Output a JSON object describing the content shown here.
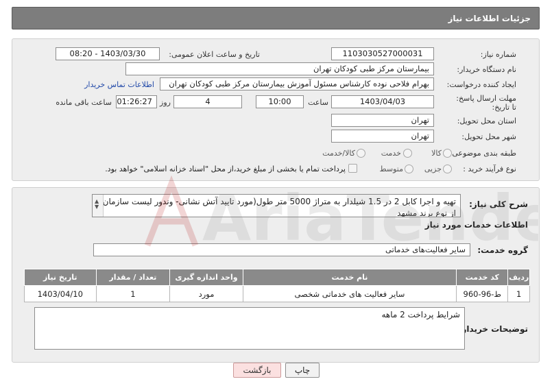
{
  "header": {
    "title": "جزئیات اطلاعات نیاز"
  },
  "details": {
    "need_number_label": "شماره نیاز:",
    "need_number": "1103030527000031",
    "announce_label": "تاریخ و ساعت اعلان عمومی:",
    "announce_value": "1403/03/30 - 08:20",
    "buyer_org_label": "نام دستگاه خریدار:",
    "buyer_org": "بیمارستان مرکز طبی کودکان تهران",
    "creator_label": "ایجاد کننده درخواست:",
    "creator": "بهرام فلاحی نوده کارشناس مسئول آموزش بیمارستان مرکز طبی کودکان تهران",
    "contact_link": "اطلاعات تماس خریدار",
    "deadline_label": "مهلت ارسال پاسخ: تا تاریخ:",
    "deadline_date": "1403/04/03",
    "time_label": "ساعت",
    "deadline_time": "10:00",
    "days_value": "4",
    "days_label": "روز و",
    "remaining_time": "01:26:27",
    "remaining_label": "ساعت باقی مانده",
    "province_label": "استان محل تحویل:",
    "province": "تهران",
    "city_label": "شهر محل تحویل:",
    "city": "تهران",
    "category_label": "طبقه بندی موضوعی:",
    "category_options": [
      "کالا",
      "خدمت",
      "کالا/خدمت"
    ],
    "process_label": "نوع فرآیند خرید :",
    "process_options": [
      "جزیی",
      "متوسط"
    ],
    "payment_note": "پرداخت تمام یا بخشی از مبلغ خرید،از محل \"اسناد خزانه اسلامی\" خواهد بود."
  },
  "summary": {
    "label": "شرح کلی نیاز:",
    "text": "تهیه و اجرا کابل 2 در 1.5 شیلدار به متراژ 5000 متر طول(مورد تایید آتش نشانی- وندور لیست سازمان) از نوع برند مشهد"
  },
  "services": {
    "section_title": "اطلاعات خدمات مورد نیاز",
    "group_label": "گروه خدمت:",
    "group_value": "سایر فعالیت‌های خدماتی",
    "columns": [
      "ردیف",
      "کد خدمت",
      "نام خدمت",
      "واحد اندازه گیری",
      "تعداد / مقدار",
      "تاریخ نیاز"
    ],
    "rows": [
      [
        "1",
        "ط-96-960",
        "سایر فعالیت های خدماتی شخصی",
        "مورد",
        "1",
        "1403/04/10"
      ]
    ]
  },
  "buyer_notes": {
    "label": "توضیحات خریدار:",
    "text": "شرایط پرداخت 2 ماهه"
  },
  "buttons": {
    "print": "چاپ",
    "back": "بازگشت"
  },
  "watermark": {
    "text": "AriaTender.neT"
  },
  "colors": {
    "header_bg": "#7d7d7d",
    "panel_bg": "#eeeeee",
    "table_header": "#8a8a8a",
    "link": "#2048a8",
    "back_button": "#fbe0e0"
  }
}
